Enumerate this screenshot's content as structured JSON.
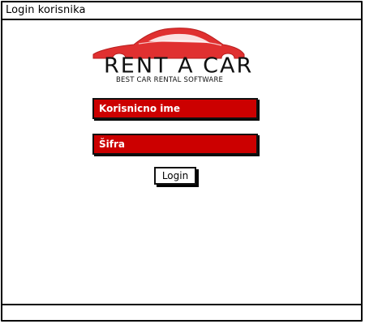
{
  "window": {
    "title": "Login korisnika"
  },
  "logo": {
    "brand": "RENT A CAR",
    "tagline": "BEST CAR RENTAL SOFTWARE",
    "icon": "car-silhouette-icon",
    "color": "#e03030"
  },
  "form": {
    "username_placeholder": "Korisnicno ime",
    "password_placeholder": "Šifra",
    "field_color": "#cc0000",
    "login_label": "Login"
  }
}
